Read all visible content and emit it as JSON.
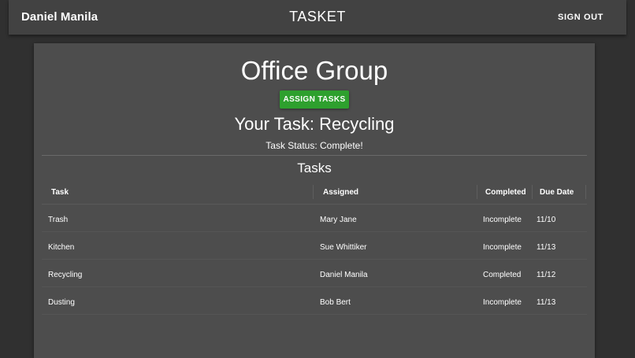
{
  "header": {
    "user_name": "Daniel Manila",
    "app_title": "TASKET",
    "sign_out_label": "SIGN OUT"
  },
  "group": {
    "name": "Office Group",
    "assign_button_label": "ASSIGN TASKS",
    "your_task": "Your Task: Recycling",
    "task_status": "Task Status: Complete!"
  },
  "tasks": {
    "title": "Tasks",
    "columns": [
      "Task",
      "Assigned",
      "Completed",
      "Due Date"
    ],
    "rows": [
      [
        "Trash",
        "Mary Jane",
        "Incomplete",
        "11/10"
      ],
      [
        "Kitchen",
        "Sue Whittiker",
        "Incomplete",
        "11/13"
      ],
      [
        "Recycling",
        "Daniel Manila",
        "Completed",
        "11/12"
      ],
      [
        "Dusting",
        "Bob Bert",
        "Incomplete",
        "11/13"
      ]
    ]
  },
  "colors": {
    "background": "#303030",
    "appbar": "#424242",
    "card": "#4d4d4d",
    "accent_button": "#2ea02e"
  }
}
